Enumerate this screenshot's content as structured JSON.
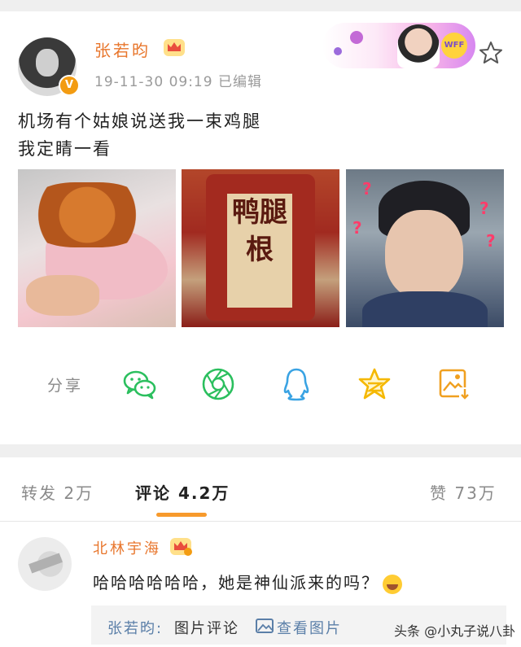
{
  "post": {
    "author": "张若昀",
    "time": "19-11-30 09:19",
    "edited": "已编辑",
    "text_lines": [
      "机场有个姑娘说送我一束鸡腿",
      "我定睛一看"
    ],
    "banner_badge": "WFF",
    "package_text": "鸭腿根"
  },
  "share": {
    "label": "分享",
    "icons": [
      "wechat-icon",
      "moments-icon",
      "qq-icon",
      "qzone-icon",
      "save-image-icon"
    ]
  },
  "tabs": {
    "repost": "转发 2万",
    "comments": "评论 4.2万",
    "likes": "赞 73万"
  },
  "comment": {
    "author": "北林宇海",
    "text": "哈哈哈哈哈哈，她是神仙派来的吗？",
    "reply_author": "张若昀:",
    "reply_text": "图片评论",
    "reply_link": "查看图片"
  },
  "watermark": "头条 @小丸子说八卦",
  "colors": {
    "accent_orange": "#e8762c",
    "tab_underline": "#f79a2c",
    "link_blue": "#5b7fa8",
    "wechat_green": "#2bbf5e",
    "qq_blue": "#3aa3e3",
    "qzone_yellow": "#f5b800",
    "save_orange": "#f0a020"
  }
}
